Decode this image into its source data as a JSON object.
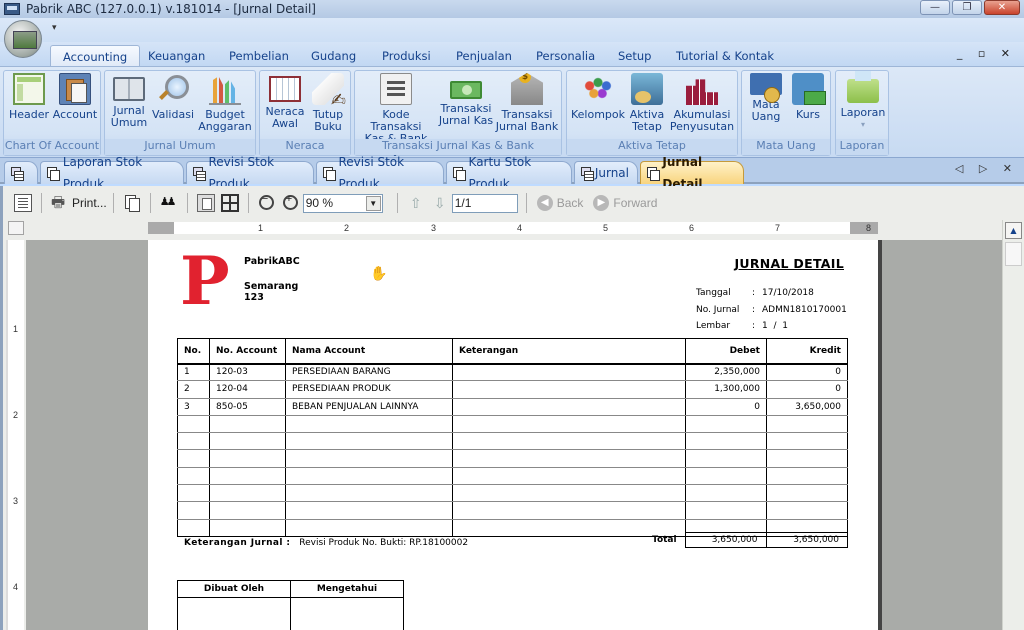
{
  "window": {
    "title": "Pabrik ABC (127.0.0.1) v.181014 - [Jurnal Detail]",
    "controls": {
      "minimize": "—",
      "restore": "❐",
      "close": "✕"
    },
    "mdi_controls": "_ ▫ ✕"
  },
  "quick_access": {
    "customize_arrow": "▾"
  },
  "ribbon_tabs": [
    {
      "label": "Accounting",
      "active": true
    },
    {
      "label": "Keuangan"
    },
    {
      "label": "Pembelian"
    },
    {
      "label": "Gudang"
    },
    {
      "label": "Produksi"
    },
    {
      "label": "Penjualan"
    },
    {
      "label": "Personalia"
    },
    {
      "label": "Setup"
    },
    {
      "label": "Tutorial & Kontak"
    }
  ],
  "ribbon_groups": [
    {
      "label": "Chart Of Account",
      "buttons": [
        {
          "line1": "Header",
          "line2": "",
          "icon": "header-icon"
        },
        {
          "line1": "Account",
          "line2": "",
          "icon": "account-icon"
        }
      ]
    },
    {
      "label": "Jurnal Umum",
      "buttons": [
        {
          "line1": "Jurnal",
          "line2": "Umum",
          "icon": "journal-book-icon"
        },
        {
          "line1": "Validasi",
          "line2": "",
          "icon": "magnifier-icon"
        },
        {
          "line1": "Budget",
          "line2": "Anggaran",
          "icon": "bar-chart-icon"
        }
      ]
    },
    {
      "label": "Neraca",
      "buttons": [
        {
          "line1": "Neraca",
          "line2": "Awal",
          "icon": "ledger-icon"
        },
        {
          "line1": "Tutup",
          "line2": "Buku",
          "icon": "scroll-pen-icon"
        }
      ]
    },
    {
      "label": "Transaksi Jurnal Kas & Bank",
      "buttons": [
        {
          "line1": "Kode Transaksi",
          "line2": "Kas & Bank",
          "icon": "list-icon"
        },
        {
          "line1": "Transaksi",
          "line2": "Jurnal Kas",
          "icon": "money-icon"
        },
        {
          "line1": "Transaksi",
          "line2": "Jurnal Bank",
          "icon": "bank-icon"
        }
      ]
    },
    {
      "label": "Aktiva Tetap",
      "buttons": [
        {
          "line1": "Kelompok",
          "line2": "",
          "icon": "people-group-icon"
        },
        {
          "line1": "Aktiva",
          "line2": "Tetap",
          "icon": "fixed-asset-icon"
        },
        {
          "line1": "Akumulasi",
          "line2": "Penyusutan",
          "icon": "depreciation-blocks-icon"
        }
      ]
    },
    {
      "label": "Mata Uang",
      "buttons": [
        {
          "line1": "Mata",
          "line2": "Uang",
          "icon": "currency-icon"
        },
        {
          "line1": "Kurs",
          "line2": "",
          "icon": "calculator-money-icon"
        }
      ]
    },
    {
      "label": "Laporan",
      "buttons": [
        {
          "line1": "Laporan",
          "line2": "▾",
          "icon": "printer-icon"
        }
      ]
    }
  ],
  "doc_tabs": [
    {
      "label": "",
      "icon": "grid"
    },
    {
      "label": "Laporan Stok Produk",
      "icon": "doc"
    },
    {
      "label": "Revisi Stok Produk",
      "icon": "grid"
    },
    {
      "label": "Revisi Stok Produk",
      "icon": "doc"
    },
    {
      "label": "Kartu Stok Produk",
      "icon": "doc"
    },
    {
      "label": "Jurnal",
      "icon": "grid"
    },
    {
      "label": "Jurnal Detail",
      "icon": "doc",
      "active": true
    }
  ],
  "doc_tab_nav": "◁ ▷ ✕",
  "preview_toolbar": {
    "print_label": "Print...",
    "zoom_value": "90 %",
    "page_value": "1/1",
    "back_label": "Back",
    "forward_label": "Forward"
  },
  "ruler": {
    "h_numbers": [
      "1",
      "2",
      "3",
      "4",
      "5",
      "6",
      "7",
      "8"
    ],
    "v_numbers": [
      "1",
      "2",
      "3",
      "4"
    ]
  },
  "report": {
    "logo_letter": "P",
    "company_name": "PabrikABC",
    "address_line1": "Semarang",
    "address_line2": "123",
    "title": "JURNAL DETAIL",
    "meta": [
      {
        "label": "Tanggal",
        "value": "17/10/2018"
      },
      {
        "label": "No. Jurnal",
        "value": "ADMN1810170001"
      },
      {
        "label": "Lembar",
        "value": "1  /  1"
      }
    ],
    "columns": [
      "No.",
      "No. Account",
      "Nama Account",
      "Keterangan",
      "Debet",
      "Kredit"
    ],
    "rows": [
      {
        "no": "1",
        "account": "120-03",
        "name": "PERSEDIAAN BARANG",
        "keterangan": "",
        "debet": "2,350,000",
        "kredit": "0"
      },
      {
        "no": "2",
        "account": "120-04",
        "name": "PERSEDIAAN PRODUK",
        "keterangan": "",
        "debet": "1,300,000",
        "kredit": "0"
      },
      {
        "no": "3",
        "account": "850-05",
        "name": "BEBAN PENJUALAN LAINNYA",
        "keterangan": "",
        "debet": "0",
        "kredit": "3,650,000"
      }
    ],
    "empty_rows": 7,
    "total_label": "Total",
    "total_debet": "3,650,000",
    "total_kredit": "3,650,000",
    "keterangan_label": "Keterangan Jurnal :",
    "keterangan_value": "Revisi Produk No. Bukti: RP.18100002",
    "sign_headers": [
      "Dibuat Oleh",
      "Mengetahui"
    ]
  }
}
